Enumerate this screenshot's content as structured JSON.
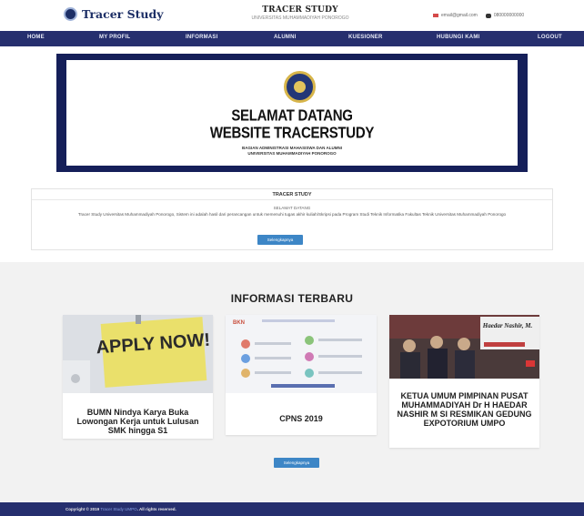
{
  "header": {
    "logo_text": "Tracer Study",
    "center_title": "TRACER STUDY",
    "center_subtitle": "UNIVERSITAS MUHAMMADIYAH PONOROGO",
    "email": "email@gmail.com",
    "phone": "080000000000"
  },
  "nav": {
    "items": [
      "HOME",
      "MY PROFIL",
      "INFORMASI",
      "ALUMNI",
      "KUESIONER",
      "HUBUNGI KAMI",
      "LOGOUT"
    ]
  },
  "banner": {
    "line1": "SELAMAT DATANG",
    "line2": "WEBSITE TRACERSTUDY",
    "line3": "BAGIAN ADMINISTRASI MAHASISWA DAN ALUMNI",
    "line4": "UNIVERSITAS MUHAMMADIYAH PONOROGO"
  },
  "tracer": {
    "heading": "TRACER STUDY",
    "sub": "SELAMAT DATANG",
    "desc": "Tracer Study Universitas Muhammadiyah Ponorogo, Sistem ini adalah hasil dari perancangan untuk memenuhi tugas akhir kuliah/Skripsi pada Program Studi Teknik Informatika Fakultas Teknik Universitas Muhammadiyah Ponorogo",
    "button": "Selengkapnya"
  },
  "info": {
    "title": "INFORMASI TERBARU",
    "cards": [
      {
        "title": "BUMN Nindya Karya Buka Lowongan Kerja untuk Lulusan SMK hingga S1",
        "image_text": "APPLY NOW!"
      },
      {
        "title": "CPNS 2019",
        "image_text": "BKN"
      },
      {
        "title": "KETUA UMUM PIMPINAN PUSAT MUHAMMADIYAH Dr H HAEDAR NASHIR M SI RESMIKAN GEDUNG EXPOTORIUM UMPO",
        "image_text": "Haedar Nashir, M."
      }
    ],
    "button": "Selengkapnya"
  },
  "footer": {
    "prefix": "Copyright © 2019",
    "site": "Tracer Study UMPO",
    "suffix": ". All rights reserved."
  },
  "colors": {
    "nav": "#262f6e",
    "banner_frame": "#151f59",
    "button": "#3d86c6"
  }
}
